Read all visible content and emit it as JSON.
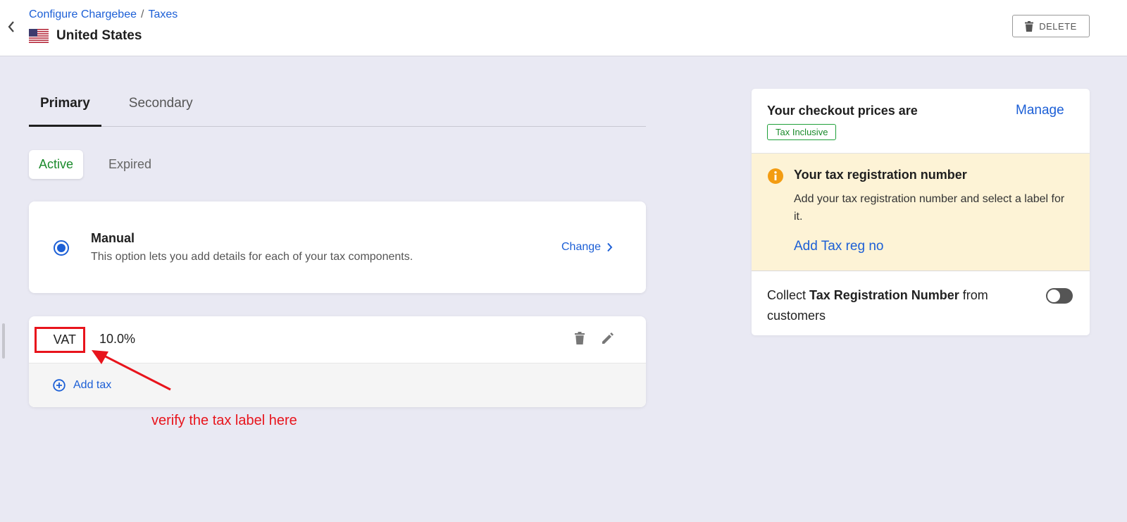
{
  "header": {
    "breadcrumb": [
      "Configure Chargebee",
      "/",
      "Taxes"
    ],
    "title": "United States",
    "delete_label": "DELETE"
  },
  "tabs": [
    "Primary",
    "Secondary"
  ],
  "subtabs": [
    "Active",
    "Expired"
  ],
  "manual": {
    "title": "Manual",
    "description": "This option lets you add details for each of your tax components.",
    "change_label": "Change"
  },
  "tax": {
    "label": "VAT",
    "rate": "10.0%",
    "add_label": "Add tax"
  },
  "annotation": "verify the tax label here",
  "checkout": {
    "title": "Your checkout prices are",
    "manage_label": "Manage",
    "badge": "Tax Inclusive"
  },
  "tax_registration": {
    "title": "Your tax registration number",
    "description": "Add your tax registration number and select a label for it.",
    "link": "Add Tax reg no"
  },
  "collect": {
    "prefix": "Collect ",
    "bold": "Tax Registration Number",
    "suffix": " from customers",
    "enabled": false
  },
  "colors": {
    "link": "#1c5fd6",
    "active_green": "#1a8a2b",
    "annotation_red": "#e8141c",
    "warning_bg": "#fdf3d6",
    "warning_icon": "#f39c12",
    "page_bg": "#e9e9f3"
  },
  "icons": [
    "chevron-left-icon",
    "us-flag-icon",
    "trash-icon",
    "radio-selected-icon",
    "chevron-right-icon",
    "pencil-icon",
    "plus-circle-icon",
    "info-icon"
  ]
}
